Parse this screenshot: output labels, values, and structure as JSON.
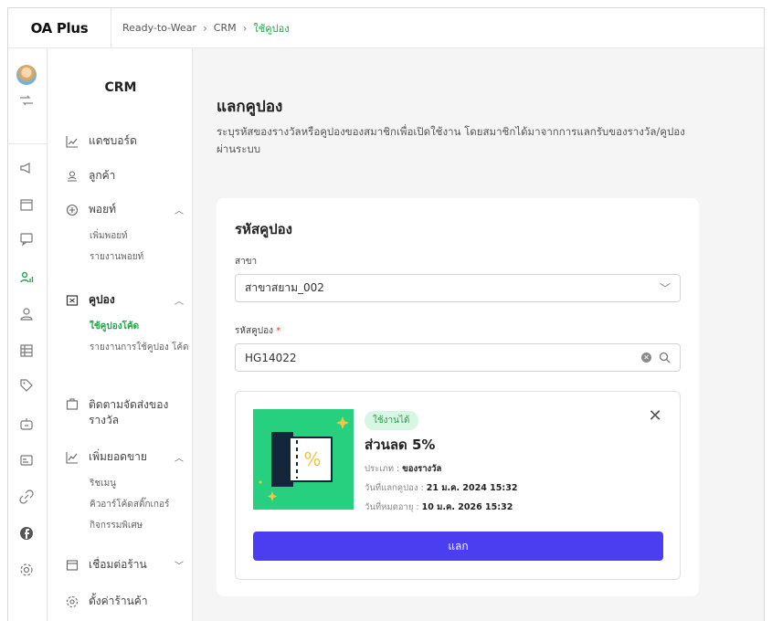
{
  "app": {
    "name": "OA Plus"
  },
  "breadcrumb": {
    "items": [
      "Ready-to-Wear",
      "CRM",
      "ใช้คูปอง"
    ]
  },
  "rail": {
    "icons": [
      "avatar",
      "switch-icon",
      "megaphone-icon",
      "store-icon",
      "chat-icon",
      "crm-icon",
      "user-icon",
      "table-icon",
      "tag-icon",
      "robot-icon",
      "card-icon",
      "link-icon",
      "facebook-icon",
      "settings-icon"
    ]
  },
  "menu": {
    "title": "CRM",
    "items": [
      {
        "label": "แดชบอร์ด"
      },
      {
        "label": "ลูกค้า"
      },
      {
        "label": "พอยท์",
        "sub": [
          "เพิ่มพอยท์",
          "รายงานพอยท์"
        ]
      },
      {
        "label": "คูปอง",
        "sub": [
          "ใช้คูปองโค้ด",
          "รายงานการใช้คูปอง โค้ด"
        ]
      },
      {
        "label": "ติดตามจัดส่งของ รางวัล"
      },
      {
        "label": "เพิ่มยอดขาย",
        "sub": [
          "ริชเมนู",
          "คิวอาร์โค้ดสติ๊กเกอร์",
          "กิจกรรมพิเศษ"
        ]
      },
      {
        "label": "เชื่อมต่อร้าน"
      },
      {
        "label": "ตั้งค่าร้านค้า"
      }
    ]
  },
  "page": {
    "title": "แลกคูปอง",
    "description": "ระบุรหัสของรางวัลหรือคูปองของสมาชิกเพื่อเปิดใช้งาน โดยสมาชิกได้มาจากการแลกรับของรางวัล/คูปองผ่านระบบ"
  },
  "form": {
    "title": "รหัสคูปอง",
    "branch_label": "สาขา",
    "branch_value": "สาขาสยาม_002",
    "code_label": "รหัสคูปอง",
    "code_required": "*",
    "code_value": "HG14022"
  },
  "coupon": {
    "status": "ใช้งานได้",
    "title": "ส่วนลด 5%",
    "type_label": "ประเภท : ",
    "type_value": "ของรางวัล",
    "redeemed_label": "วันที่แลกคูปอง : ",
    "redeemed_value": "21 ม.ค. 2024 15:32",
    "expires_label": "วันที่หมดอายุ : ",
    "expires_value": "10 ม.ค. 2026 15:32",
    "redeem_button": "แลก"
  },
  "colors": {
    "accent_green": "#27a34a",
    "coupon_bg": "#27d07f",
    "button": "#4a3ef0"
  }
}
